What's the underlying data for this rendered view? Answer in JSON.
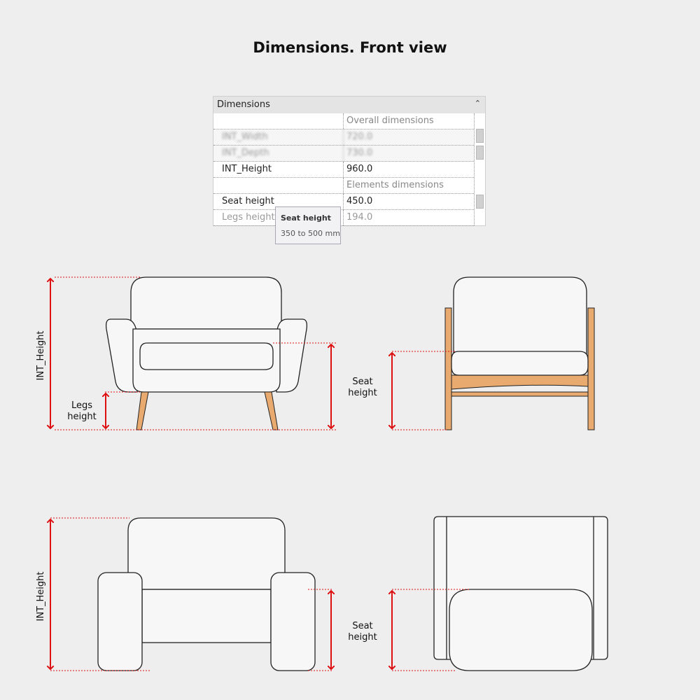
{
  "title": "Dimensions.  Front view",
  "panel": {
    "header": "Dimensions",
    "rows": [
      {
        "name": "",
        "value": "Overall dimensions"
      },
      {
        "name": "INT_Width",
        "value": "720.0"
      },
      {
        "name": "INT_Depth",
        "value": "730.0"
      },
      {
        "name": "INT_Height",
        "value": "960.0"
      },
      {
        "name": "",
        "value": "Elements dimensions"
      },
      {
        "name": "Seat height",
        "value": "450.0"
      },
      {
        "name": "Legs height",
        "value": "194.0"
      }
    ]
  },
  "tooltip": {
    "title": "Seat height",
    "range": "350 to 500 mm"
  },
  "labels": {
    "int_height": "INT_Height",
    "legs_line1": "Legs",
    "legs_line2": "height",
    "seat_line1": "Seat",
    "seat_line2": "height"
  },
  "colors": {
    "dimension": "#dd1111",
    "wood": "#e8aa6e",
    "outline": "#222222"
  }
}
